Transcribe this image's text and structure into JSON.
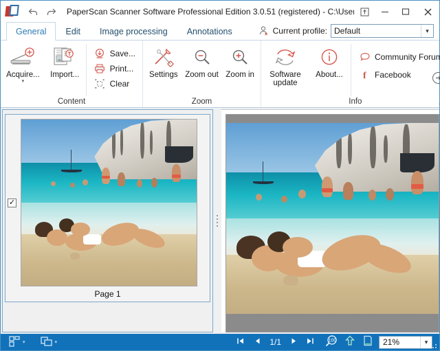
{
  "window": {
    "title": "PaperScan Scanner Software Professional Edition 3.0.51 (registered) - C:\\Users\\User\\...",
    "logo_icon": "paperscan-logo-icon",
    "back_icon": "back-arrow-icon",
    "forward_icon": "forward-arrow-icon",
    "pin_icon": "pin-window-icon",
    "minimize_icon": "minimize-icon",
    "maximize_icon": "maximize-icon",
    "close_icon": "close-icon"
  },
  "tabs": [
    {
      "label": "General",
      "active": true
    },
    {
      "label": "Edit",
      "active": false
    },
    {
      "label": "Image processing",
      "active": false
    },
    {
      "label": "Annotations",
      "active": false
    }
  ],
  "profile": {
    "icon": "user-profile-icon",
    "label": "Current profile:",
    "value": "Default",
    "caret_icon": "chevron-down-icon",
    "options": [
      "Default"
    ]
  },
  "ribbon": {
    "collapse_icon": "chevron-up-icon",
    "groups": [
      {
        "title": "Content",
        "big_buttons": [
          {
            "label": "Acquire...",
            "icon": "scanner-acquire-icon",
            "has_dropdown": true
          },
          {
            "label": "Import...",
            "icon": "import-document-icon",
            "has_dropdown": false
          }
        ],
        "small_buttons": [
          {
            "label": "Save...",
            "icon": "save-download-icon"
          },
          {
            "label": "Print...",
            "icon": "printer-icon"
          },
          {
            "label": "Clear",
            "icon": "clear-icon"
          }
        ]
      },
      {
        "title": "Zoom",
        "big_buttons": [
          {
            "label": "Settings",
            "icon": "tools-settings-icon",
            "has_dropdown": false
          },
          {
            "label": "Zoom out",
            "icon": "zoom-out-icon",
            "has_dropdown": false
          },
          {
            "label": "Zoom in",
            "icon": "zoom-in-icon",
            "has_dropdown": false
          }
        ],
        "small_buttons": []
      },
      {
        "title": "Info",
        "big_buttons": [
          {
            "label": "Software update",
            "icon": "software-update-icon",
            "has_dropdown": false
          },
          {
            "label": "About...",
            "icon": "about-info-icon",
            "has_dropdown": false
          }
        ],
        "small_buttons": [
          {
            "label": "Community Forum",
            "icon": "speech-bubble-icon"
          },
          {
            "label": "Facebook",
            "icon": "facebook-icon"
          }
        ],
        "dialog_launcher_icon": "open-dialog-arrow-icon"
      }
    ]
  },
  "thumbnails": {
    "items": [
      {
        "caption": "Page 1",
        "checked": true,
        "check_icon": "checkmark-icon",
        "image": "beach-photo"
      }
    ]
  },
  "splitter": {
    "icon": "splitter-grip-icon"
  },
  "viewer": {
    "image": "beach-photo"
  },
  "statusbar": {
    "left_buttons": [
      {
        "icon": "page-layout-icon",
        "caret_icon": "chevron-down-icon"
      },
      {
        "icon": "view-mode-icon",
        "caret_icon": "chevron-down-icon"
      }
    ],
    "first_page_icon": "first-page-icon",
    "prev_page_icon": "previous-page-icon",
    "page_info": "1/1",
    "next_page_icon": "next-page-icon",
    "last_page_icon": "last-page-icon",
    "zoom_100_icon": "zoom-100-percent-icon",
    "fit_width_icon": "fit-width-icon",
    "fit_page_icon": "fit-page-icon",
    "zoom_value": "21%",
    "zoom_caret_icon": "chevron-down-icon",
    "zoom_options": [
      "21%"
    ],
    "resize_grip_icon": "resize-grip-icon"
  },
  "colors": {
    "accent_blue": "#1172ba",
    "ribbon_icon_red": "#d4564b",
    "tab_active": "#2d7cb5",
    "panel_border": "#7aa8cc"
  }
}
